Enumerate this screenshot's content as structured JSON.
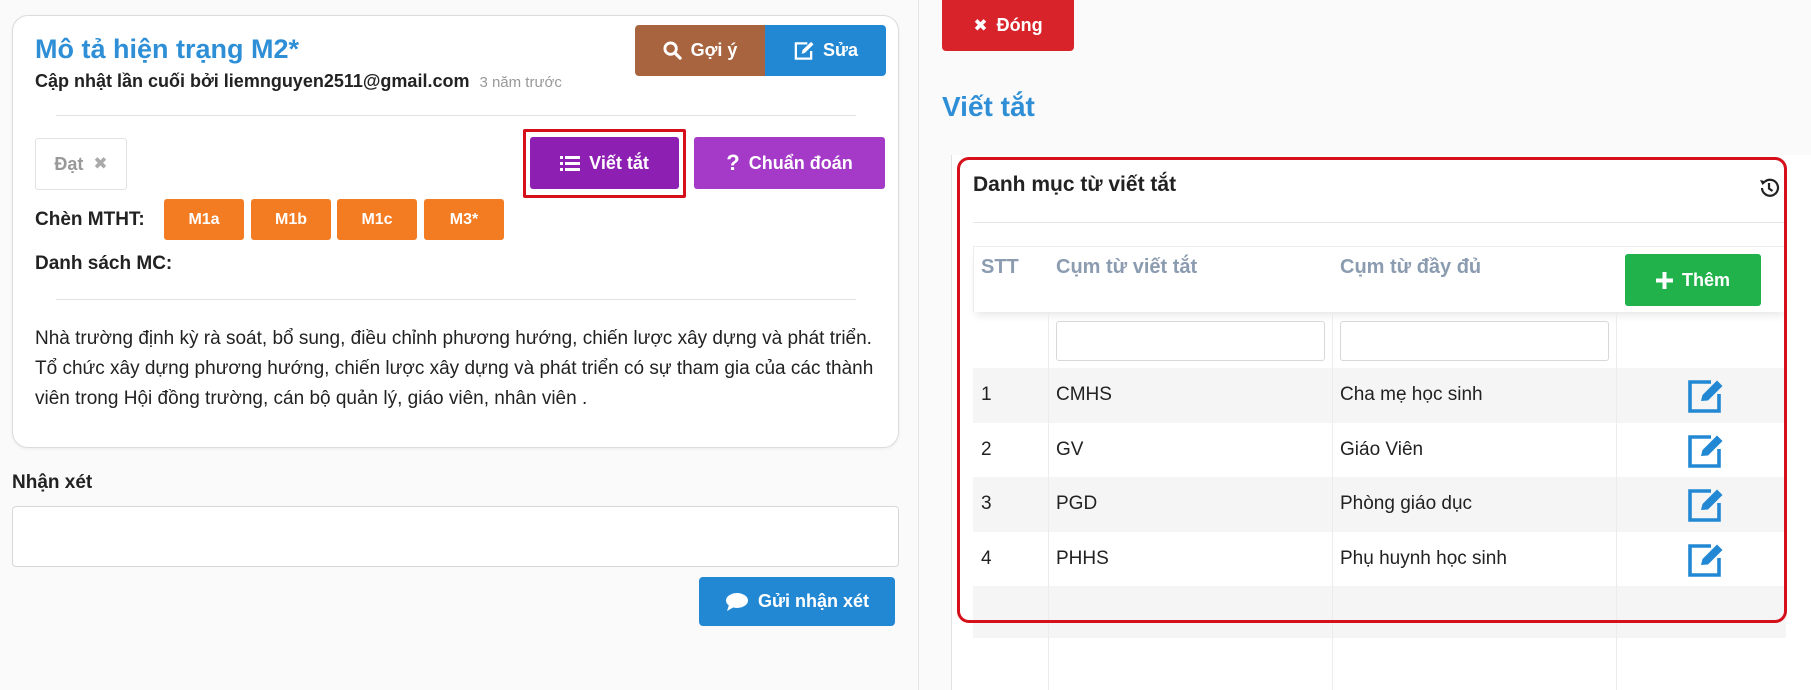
{
  "left": {
    "title": "Mô tả hiện trạng M2*",
    "updated_by": "Cập nhật lần cuối bởi liemnguyen2511@gmail.com",
    "updated_ago": "3 năm trước",
    "goiy_label": "Gợi ý",
    "sua_label": "Sửa",
    "dat_label": "Đạt",
    "viettat_label": "Viết tắt",
    "chuandoan_label": "Chuẩn đoán",
    "chen_label": "Chèn MTHT:",
    "m_buttons": [
      "M1a",
      "M1b",
      "M1c",
      "M3*"
    ],
    "danhsach_label": "Danh sách MC:",
    "paragraph": "Nhà trường định kỳ rà soát, bổ sung, điều chỉnh phương hướng, chiến lược xây dựng và phát triển. Tổ chức xây dựng phương hướng, chiến lược xây dựng và phát triển có sự tham gia của các thành viên trong Hội đồng trường, cán bộ quản lý, giáo viên, nhân viên  .",
    "nhanxet_label": "Nhận xét",
    "nhanxet_value": "",
    "gui_label": "Gửi nhận xét"
  },
  "right": {
    "dong_label": "Đóng",
    "heading": "Viết tắt",
    "card_title": "Danh mục từ viết tắt",
    "columns": [
      "STT",
      "Cụm từ viết tắt",
      "Cụm từ đầy đủ"
    ],
    "them_label": "Thêm",
    "filter_short": "",
    "filter_full": "",
    "rows": [
      {
        "stt": "1",
        "short": "CMHS",
        "full": "Cha mẹ học sinh"
      },
      {
        "stt": "2",
        "short": "GV",
        "full": "Giáo Viên"
      },
      {
        "stt": "3",
        "short": "PGD",
        "full": "Phòng giáo dục"
      },
      {
        "stt": "4",
        "short": "PHHS",
        "full": "Phụ huynh học sinh"
      }
    ]
  },
  "colors": {
    "accent_blue": "#2f8fd6",
    "brown": "#a7643f",
    "purple": "#8e1fb3",
    "orange": "#f37b22",
    "green": "#22b24c",
    "red": "#d9232b",
    "highlight_outline": "#d5101a"
  },
  "icons": [
    "search-icon",
    "edit-icon",
    "close-icon",
    "list-icon",
    "question-icon",
    "comment-icon",
    "plus-icon",
    "history-icon"
  ]
}
